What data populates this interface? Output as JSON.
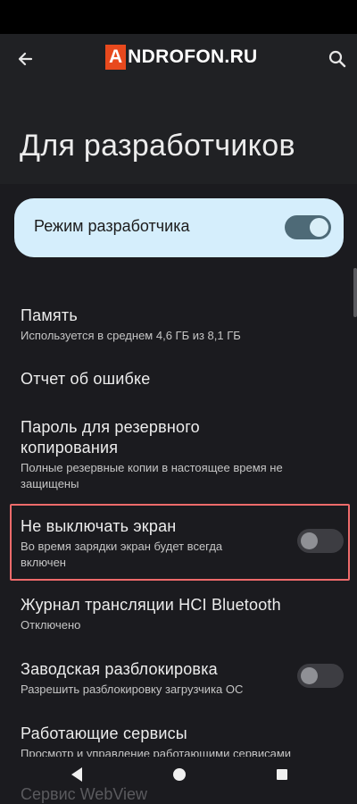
{
  "header": {
    "logo_letter": "A",
    "logo_rest": "NDROFON.RU",
    "page_title": "Для разработчиков"
  },
  "developer_mode": {
    "label": "Режим разработчика",
    "enabled": true
  },
  "items": [
    {
      "title": "Память",
      "subtitle": "Используется в среднем 4,6 ГБ из 8,1 ГБ"
    },
    {
      "title": "Отчет об ошибке"
    },
    {
      "title_line1": "Пароль для резервного",
      "title_line2": "копирования",
      "subtitle_line1": "Полные резервные копии в настоящее время не",
      "subtitle_line2": "защищены"
    },
    {
      "title": "Не выключать экран",
      "subtitle_line1": "Во время зарядки экран будет всегда",
      "subtitle_line2": "включен",
      "enabled": false
    },
    {
      "title": "Журнал трансляции HCI Bluetooth",
      "subtitle": "Отключено"
    },
    {
      "title": "Заводская разблокировка",
      "subtitle": "Разрешить разблокировку загрузчика ОС",
      "enabled": false
    },
    {
      "title": "Работающие сервисы",
      "subtitle": "Просмотр и управление работающими сервисами"
    }
  ],
  "clipped_item_text": "Сервис WebView",
  "icons": [
    "back-arrow-icon",
    "search-icon",
    "nav-back-icon",
    "nav-home-icon",
    "nav-recents-icon"
  ],
  "colors": {
    "accent_card": "#d5eefc",
    "highlight_border": "#ef6b6b",
    "logo_red": "#e8491d"
  }
}
